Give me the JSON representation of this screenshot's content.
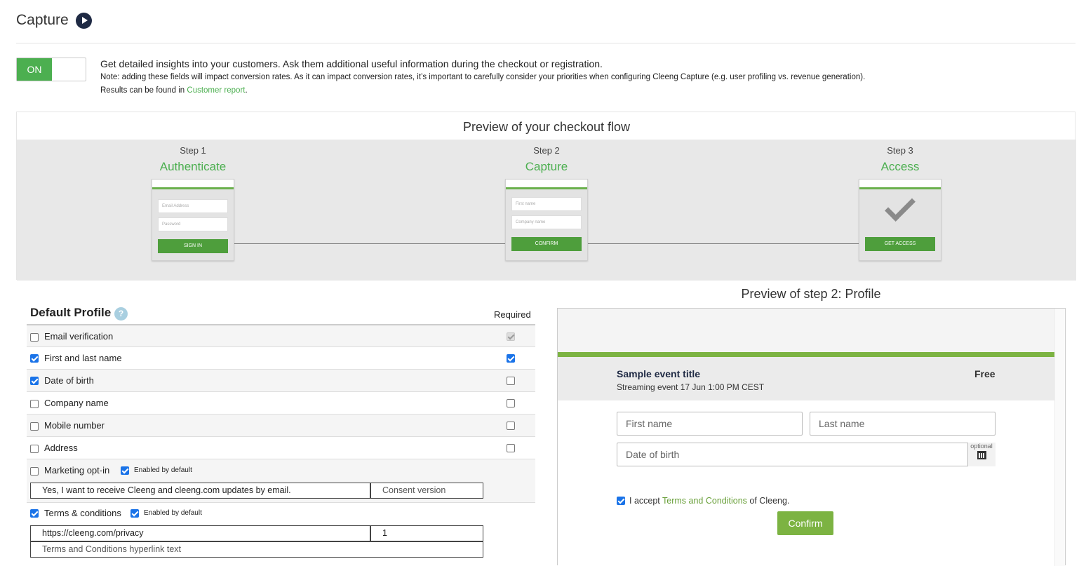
{
  "header": {
    "title": "Capture",
    "play_icon": "play-circle-icon"
  },
  "toggle": {
    "label": "ON",
    "state": "on"
  },
  "intro": {
    "main": "Get detailed insights into your customers. Ask them additional useful information during the checkout or registration.",
    "note": "Note: adding these fields will impact conversion rates. As it can impact conversion rates, it’s important to carefully consider your priorities when configuring Cleeng Capture (e.g. user profiling vs. revenue generation).",
    "results_prefix": "Results can be found in ",
    "results_link": "Customer report",
    "results_suffix": "."
  },
  "flow": {
    "title": "Preview of your checkout flow",
    "steps": [
      {
        "num": "Step 1",
        "name": "Authenticate",
        "inputs": [
          "Email Address",
          "Password"
        ],
        "button": "SIGN IN"
      },
      {
        "num": "Step 2",
        "name": "Capture",
        "inputs": [
          "First name",
          "Company name"
        ],
        "button": "CONFIRM"
      },
      {
        "num": "Step 3",
        "name": "Access",
        "inputs": [],
        "button": "GET ACCESS",
        "icon": "checkmark-icon"
      }
    ]
  },
  "profile": {
    "title": "Default Profile",
    "help_icon": "?",
    "required_label": "Required",
    "rows": [
      {
        "label": "Email verification",
        "checked": false,
        "required": true,
        "required_disabled": true
      },
      {
        "label": "First and last name",
        "checked": true,
        "required": true
      },
      {
        "label": "Date of birth",
        "checked": true,
        "required": false
      },
      {
        "label": "Company name",
        "checked": false,
        "required": false
      },
      {
        "label": "Mobile number",
        "checked": false,
        "required": false
      },
      {
        "label": "Address",
        "checked": false,
        "required": false
      }
    ],
    "marketing": {
      "label": "Marketing opt-in",
      "checked": false,
      "enabled_label": "Enabled by default",
      "enabled": true,
      "text_value": "Yes, I want to receive Cleeng and cleeng.com updates by email.",
      "version_placeholder": "Consent version"
    },
    "terms": {
      "label": "Terms & conditions",
      "checked": true,
      "enabled_label": "Enabled by default",
      "enabled": true,
      "url_value": "https://cleeng.com/privacy",
      "version_value": "1",
      "link_text_placeholder": "Terms and Conditions hyperlink text"
    }
  },
  "preview": {
    "title": "Preview of step 2: Profile",
    "event_title": "Sample event title",
    "event_sub": "Streaming event 17 Jun 1:00 PM CEST",
    "price": "Free",
    "first_name_placeholder": "First name",
    "last_name_placeholder": "Last name",
    "dob_placeholder": "Date of birth",
    "optional_label": "optional",
    "calendar_icon": "calendar-icon",
    "accept_prefix": "I accept ",
    "accept_link": "Terms and Conditions",
    "accept_suffix": " of Cleeng.",
    "confirm": "Confirm"
  },
  "colors": {
    "accent_green": "#4caf50",
    "preview_green": "#7cb342",
    "navy": "#1f2a44"
  }
}
